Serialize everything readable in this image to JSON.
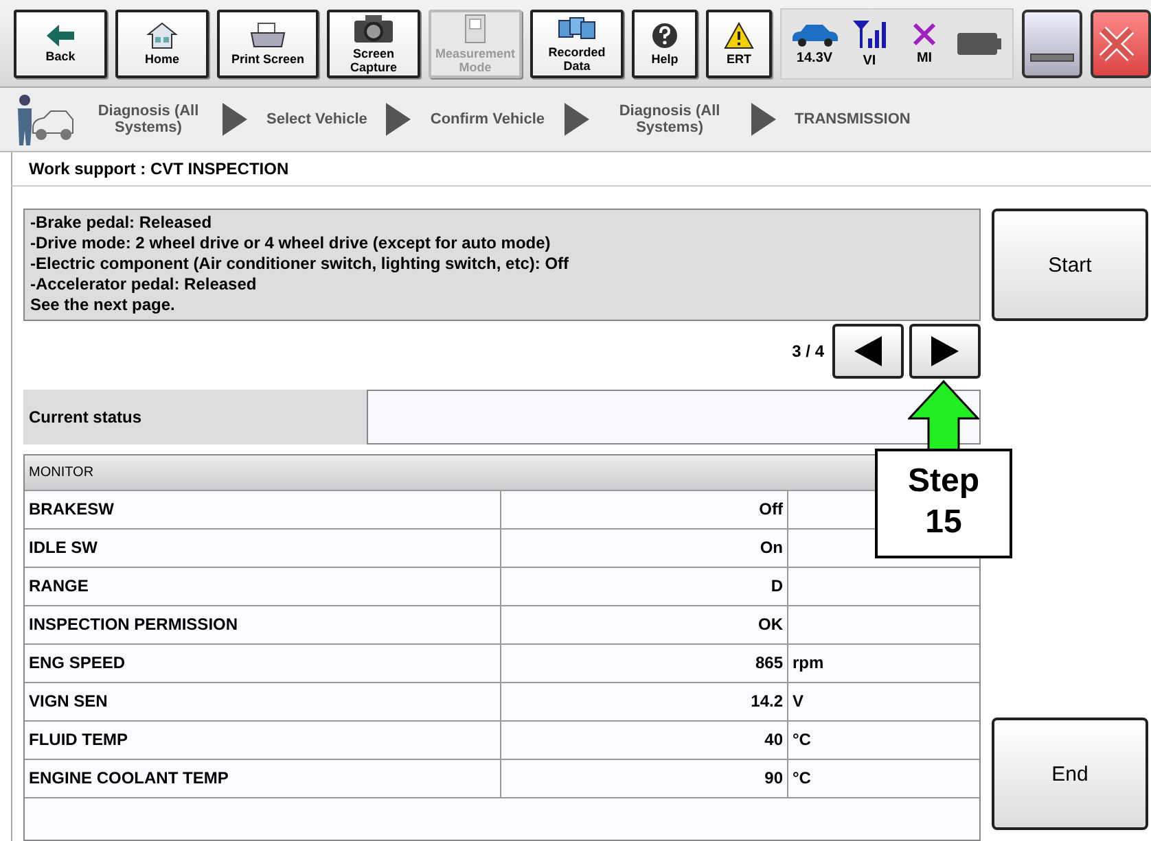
{
  "toolbar": {
    "buttons": [
      {
        "kind": "back",
        "label": "Back",
        "disabled": false
      },
      {
        "kind": "home",
        "label": "Home",
        "disabled": false
      },
      {
        "kind": "print",
        "label": "Print Screen",
        "disabled": false
      },
      {
        "kind": "camera",
        "label": "Screen Capture",
        "disabled": false
      },
      {
        "kind": "measure",
        "label": "Measurement Mode",
        "disabled": true
      },
      {
        "kind": "recorded",
        "label": "Recorded Data",
        "disabled": false
      },
      {
        "kind": "help",
        "label": "Help",
        "disabled": false
      },
      {
        "kind": "ert",
        "label": "ERT",
        "disabled": false
      }
    ],
    "status": [
      {
        "kind": "car",
        "label": "14.3V"
      },
      {
        "kind": "signal",
        "label": "VI"
      },
      {
        "kind": "cross",
        "label": "MI"
      },
      {
        "kind": "battery"
      }
    ]
  },
  "breadcrumb": [
    "Diagnosis (All Systems)",
    "Select Vehicle",
    "Confirm Vehicle",
    "Diagnosis (All Systems)",
    "TRANSMISSION"
  ],
  "title": "Work support : CVT INSPECTION",
  "instructions": [
    "-Brake pedal: Released",
    "-Drive mode: 2 wheel drive or 4 wheel drive (except for auto mode)",
    "-Electric component (Air conditioner switch, lighting switch, etc): Off",
    "-Accelerator pedal: Released",
    "See the next page."
  ],
  "start_button": "Start",
  "page_indicator": "3 / 4",
  "current_status": {
    "label": "Current status"
  },
  "monitor": {
    "header": "MONITOR",
    "rows": [
      {
        "name": "BRAKESW",
        "value": "Off"
      },
      {
        "name": "IDLE SW",
        "value": "On"
      },
      {
        "name": "RANGE",
        "value": "D"
      },
      {
        "name": "INSPECTION PERMISSION",
        "value": "OK"
      },
      {
        "name": "ENG SPEED",
        "value": "865",
        "unit": "rpm"
      },
      {
        "name": "VIGN SEN",
        "value": "14.2",
        "unit": "V"
      },
      {
        "name": "FLUID TEMP",
        "value": "40",
        "unit": "°C"
      },
      {
        "name": "ENGINE COOLANT TEMP",
        "value": "90",
        "unit": "°C"
      }
    ]
  },
  "end_button": "End",
  "callout": {
    "text": "Step 15"
  }
}
